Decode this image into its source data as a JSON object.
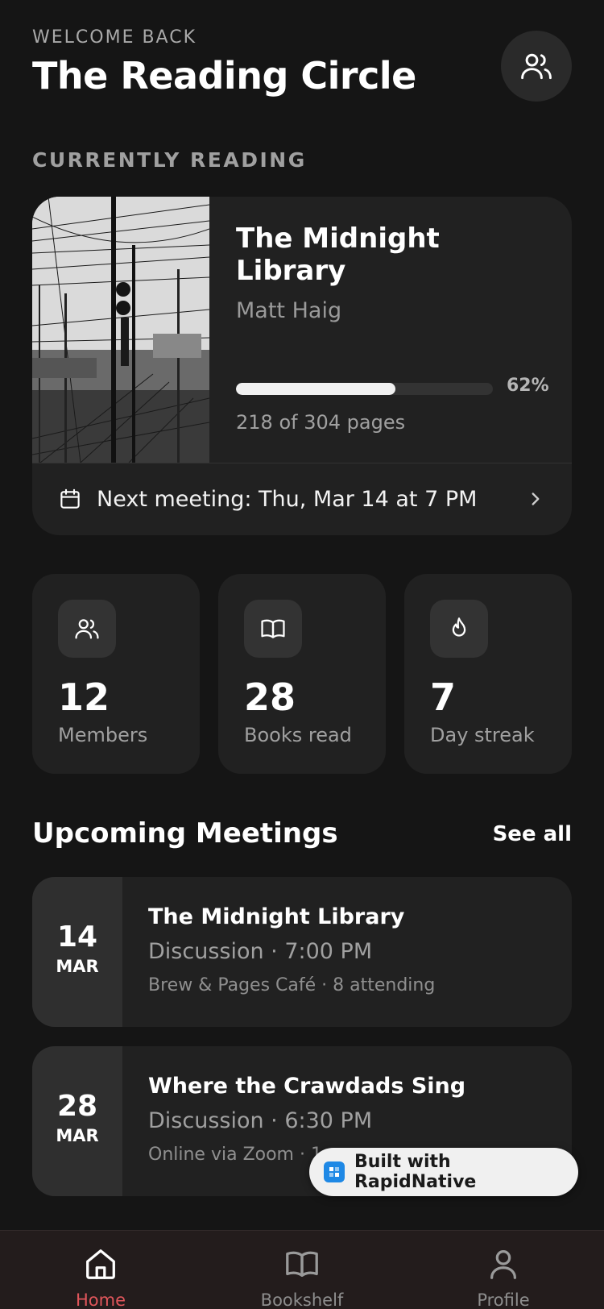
{
  "header": {
    "welcome": "WELCOME BACK",
    "title": "The Reading Circle",
    "group_icon": "users-icon"
  },
  "current": {
    "section_label": "CURRENTLY READING",
    "book_title": "The Midnight Library",
    "author": "Matt Haig",
    "progress_fraction": 0.62,
    "progress_label": "62%",
    "pages": "218 of 304 pages",
    "next_meeting": "Next meeting: Thu, Mar 14 at 7 PM",
    "calendar_icon": "calendar-icon",
    "chevron_icon": "chevron-right-icon"
  },
  "stats": [
    {
      "value": "12",
      "label": "Members",
      "icon": "users-icon"
    },
    {
      "value": "28",
      "label": "Books read",
      "icon": "book-open-icon"
    },
    {
      "value": "7",
      "label": "Day streak",
      "icon": "flame-icon"
    }
  ],
  "upcoming": {
    "title": "Upcoming Meetings",
    "see_all": "See all",
    "meetings": [
      {
        "day": "14",
        "month": "MAR",
        "title": "The Midnight Library",
        "subtitle": "Discussion · 7:00 PM",
        "location": "Brew & Pages Café · 8 attending"
      },
      {
        "day": "28",
        "month": "MAR",
        "title": "Where the Crawdads Sing",
        "subtitle": "Discussion · 6:30 PM",
        "location": "Online via Zoom · 1"
      }
    ]
  },
  "badge": {
    "text": "Built with RapidNative"
  },
  "tabs": [
    {
      "label": "Home",
      "icon": "home-icon",
      "active": true
    },
    {
      "label": "Bookshelf",
      "icon": "book-open-icon",
      "active": false
    },
    {
      "label": "Profile",
      "icon": "user-icon",
      "active": false
    }
  ],
  "colors": {
    "background": "#151515",
    "card": "#212121",
    "accent": "#e0565b",
    "progress": "#f1f1f1"
  }
}
